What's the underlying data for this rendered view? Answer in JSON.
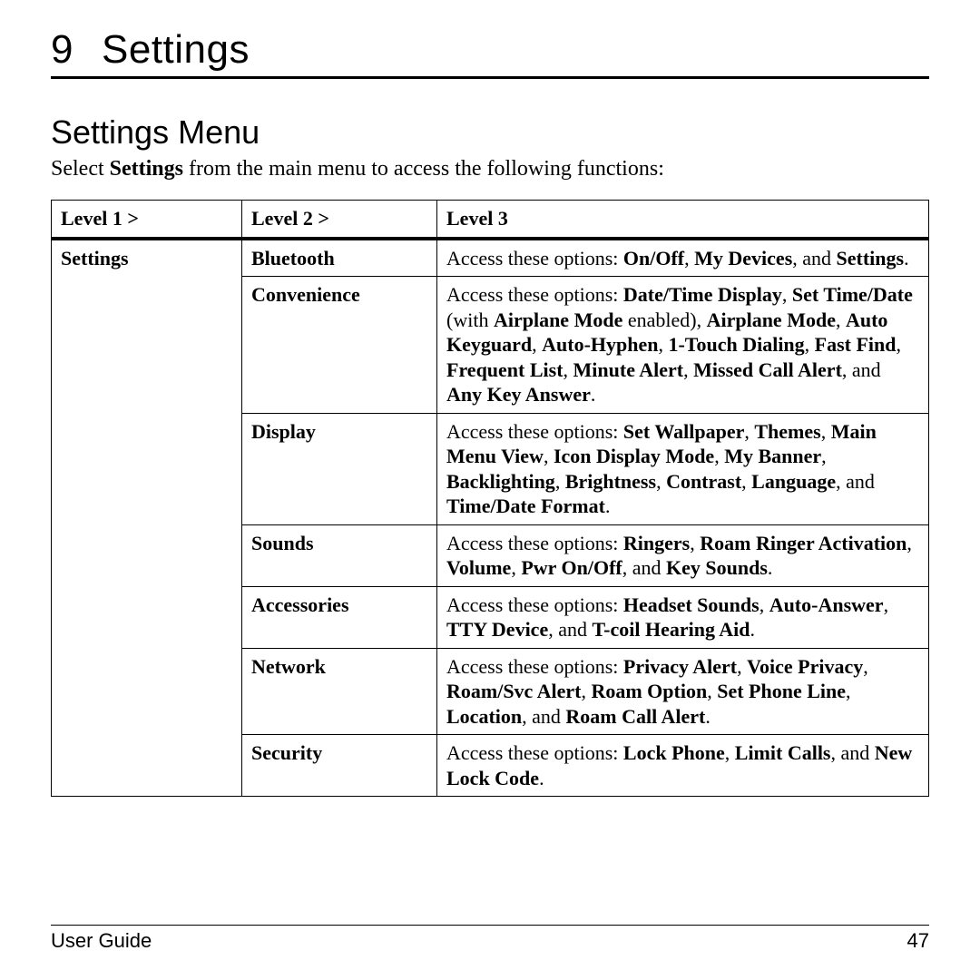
{
  "chapter": {
    "number": "9",
    "title": "Settings"
  },
  "section_title": "Settings Menu",
  "intro": {
    "pre": "Select ",
    "bold": "Settings",
    "post": " from the main menu to access the following functions:"
  },
  "headers": {
    "c1": "Level 1 >",
    "c2": "Level 2 >",
    "c3": "Level 3"
  },
  "level1": "Settings",
  "rows": [
    {
      "l2": "Bluetooth",
      "segments": [
        {
          "t": "Access these options: "
        },
        {
          "t": "On/Off",
          "b": true
        },
        {
          "t": ", "
        },
        {
          "t": "My Devices",
          "b": true
        },
        {
          "t": ", and "
        },
        {
          "t": "Settings",
          "b": true
        },
        {
          "t": "."
        }
      ]
    },
    {
      "l2": "Convenience",
      "segments": [
        {
          "t": "Access these options: "
        },
        {
          "t": "Date/Time Display",
          "b": true
        },
        {
          "t": ", "
        },
        {
          "t": "Set Time/Date",
          "b": true
        },
        {
          "t": " (with "
        },
        {
          "t": "Airplane Mode",
          "b": true
        },
        {
          "t": " enabled), "
        },
        {
          "t": "Airplane Mode",
          "b": true
        },
        {
          "t": ", "
        },
        {
          "t": "Auto Keyguard",
          "b": true
        },
        {
          "t": ", "
        },
        {
          "t": "Auto-Hyphen",
          "b": true
        },
        {
          "t": ", "
        },
        {
          "t": "1-Touch Dialing",
          "b": true
        },
        {
          "t": ", "
        },
        {
          "t": "Fast Find",
          "b": true
        },
        {
          "t": ", "
        },
        {
          "t": "Frequent List",
          "b": true
        },
        {
          "t": ", "
        },
        {
          "t": "Minute Alert",
          "b": true
        },
        {
          "t": ", "
        },
        {
          "t": "Missed Call Alert",
          "b": true
        },
        {
          "t": ", and "
        },
        {
          "t": "Any Key Answer",
          "b": true
        },
        {
          "t": "."
        }
      ]
    },
    {
      "l2": "Display",
      "segments": [
        {
          "t": "Access these options: "
        },
        {
          "t": "Set Wallpaper",
          "b": true
        },
        {
          "t": ", "
        },
        {
          "t": "Themes",
          "b": true
        },
        {
          "t": ", "
        },
        {
          "t": "Main Menu View",
          "b": true
        },
        {
          "t": ", "
        },
        {
          "t": "Icon Display Mode",
          "b": true
        },
        {
          "t": ", "
        },
        {
          "t": "My Banner",
          "b": true
        },
        {
          "t": ", "
        },
        {
          "t": "Backlighting",
          "b": true
        },
        {
          "t": ", "
        },
        {
          "t": "Brightness",
          "b": true
        },
        {
          "t": ", "
        },
        {
          "t": "Contrast",
          "b": true
        },
        {
          "t": ", "
        },
        {
          "t": "Language",
          "b": true
        },
        {
          "t": ", and "
        },
        {
          "t": "Time/Date Format",
          "b": true
        },
        {
          "t": "."
        }
      ]
    },
    {
      "l2": "Sounds",
      "segments": [
        {
          "t": "Access these options: "
        },
        {
          "t": "Ringers",
          "b": true
        },
        {
          "t": ", "
        },
        {
          "t": "Roam Ringer Activation",
          "b": true
        },
        {
          "t": ", "
        },
        {
          "t": "Volume",
          "b": true
        },
        {
          "t": ", "
        },
        {
          "t": "Pwr On/Off",
          "b": true
        },
        {
          "t": ", and "
        },
        {
          "t": "Key Sounds",
          "b": true
        },
        {
          "t": "."
        }
      ]
    },
    {
      "l2": "Accessories",
      "segments": [
        {
          "t": "Access these options: "
        },
        {
          "t": "Headset Sounds",
          "b": true
        },
        {
          "t": ", "
        },
        {
          "t": "Auto-Answer",
          "b": true
        },
        {
          "t": ", "
        },
        {
          "t": "TTY Device",
          "b": true
        },
        {
          "t": ", and "
        },
        {
          "t": "T-coil Hearing Aid",
          "b": true
        },
        {
          "t": "."
        }
      ]
    },
    {
      "l2": "Network",
      "segments": [
        {
          "t": "Access these options: "
        },
        {
          "t": "Privacy Alert",
          "b": true
        },
        {
          "t": ", "
        },
        {
          "t": "Voice Privacy",
          "b": true
        },
        {
          "t": ", "
        },
        {
          "t": "Roam/Svc Alert",
          "b": true
        },
        {
          "t": ", "
        },
        {
          "t": "Roam Option",
          "b": true
        },
        {
          "t": ", "
        },
        {
          "t": "Set Phone Line",
          "b": true
        },
        {
          "t": ", "
        },
        {
          "t": "Location",
          "b": true
        },
        {
          "t": ", and "
        },
        {
          "t": "Roam Call Alert",
          "b": true
        },
        {
          "t": "."
        }
      ]
    },
    {
      "l2": "Security",
      "segments": [
        {
          "t": "Access these options: "
        },
        {
          "t": "Lock Phone",
          "b": true
        },
        {
          "t": ", "
        },
        {
          "t": "Limit Calls",
          "b": true
        },
        {
          "t": ", and "
        },
        {
          "t": "New Lock Code",
          "b": true
        },
        {
          "t": "."
        }
      ]
    }
  ],
  "footer": {
    "left": "User Guide",
    "right": "47"
  }
}
